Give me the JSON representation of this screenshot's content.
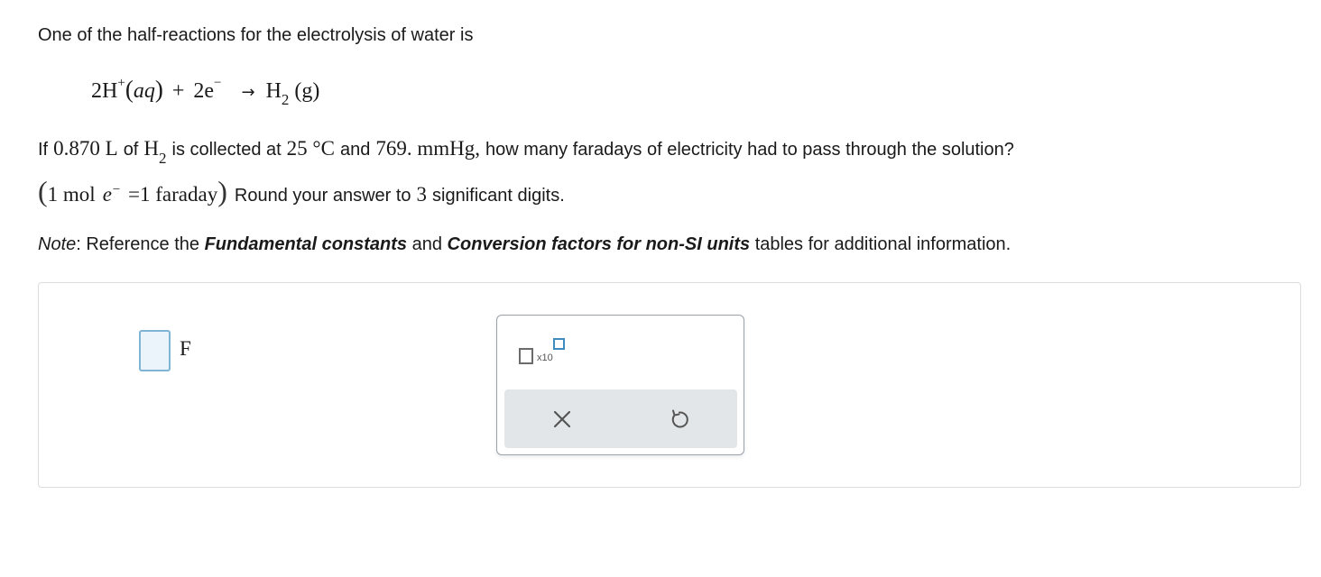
{
  "intro": "One of the half-reactions for the electrolysis of water is",
  "equation": {
    "coef1": "2H",
    "ion_charge": "+",
    "open_paren": "(",
    "state1": "aq",
    "close_paren": ")",
    "plus": "+",
    "electrons": "2e",
    "electron_charge": "−",
    "arrow": "→",
    "product": "H",
    "product_sub": "2",
    "state2": "(g)"
  },
  "question": {
    "part1": "If",
    "volume": "0.870 L",
    "part2": "of",
    "gas": "H",
    "gas_sub": "2",
    "part3": "is collected at",
    "temperature": "25 °C",
    "part4": "and",
    "pressure": "769. mmHg,",
    "part5": "how many faradays of electricity had to pass through the solution?"
  },
  "hint": {
    "open": "(",
    "mole_text": "1 mol",
    "electron": "e",
    "electron_charge": "−",
    "equals": "=",
    "faraday_text": "1 faraday",
    "close": ")",
    "round_part1": "Round your answer to",
    "digits": "3",
    "round_part2": "significant digits."
  },
  "note": {
    "label": "Note",
    "colon": ": Reference the",
    "link1": "Fundamental constants",
    "and": "and",
    "link2": "Conversion factors for non-SI units",
    "tail": "tables for additional information."
  },
  "answer": {
    "value": "",
    "unit": "F"
  },
  "toolbar": {
    "sci_label": "x10",
    "icons": [
      "scientific-notation-icon",
      "clear-icon",
      "undo-icon"
    ]
  },
  "colors": {
    "input_fill": "#eaf4fa",
    "input_border": "#7fb4d6",
    "action_bar": "#e3e6e8",
    "icon_stroke": "#555555",
    "exponent_box": "#3f8cc0"
  }
}
